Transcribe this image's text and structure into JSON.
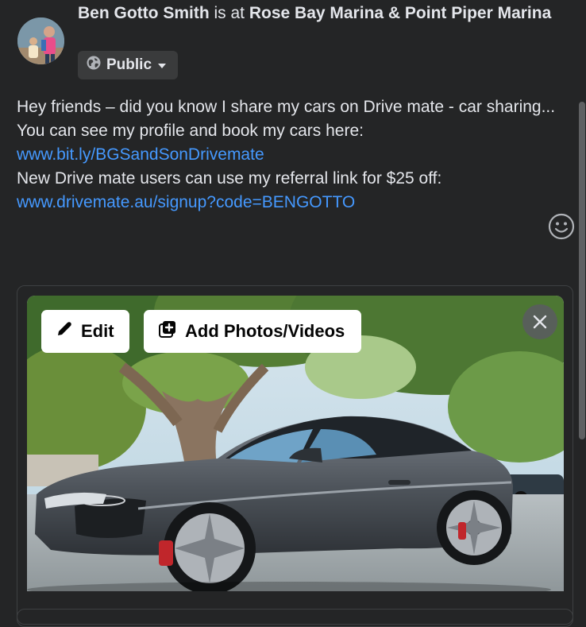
{
  "header": {
    "user_name": "Ben Gotto Smith",
    "connector": " is at ",
    "location": "Rose Bay Marina & Point Piper Marina"
  },
  "audience": {
    "label": "Public",
    "icon": "globe-icon",
    "chevron_icon": "caret-down-icon"
  },
  "post": {
    "line1": "Hey friends – did you know I share my cars on Drive mate - car sharing...",
    "line2": "You can see my profile and book my cars here:",
    "link1": "www.bit.ly/BGSandSonDrivemate",
    "line3": "New Drive mate users can use my referral link for $25 off:",
    "link2": "www.drivemate.au/signup?code=BENGOTTO"
  },
  "emoji_button": {
    "icon": "smiley-icon"
  },
  "media": {
    "edit_label": "Edit",
    "edit_icon": "pencil-icon",
    "add_label": "Add Photos/Videos",
    "add_icon": "add-photo-icon",
    "close_icon": "close-icon"
  },
  "colors": {
    "background": "#242526",
    "text": "#e4e6eb",
    "link": "#4599ff",
    "button_bg": "#3a3b3c"
  }
}
